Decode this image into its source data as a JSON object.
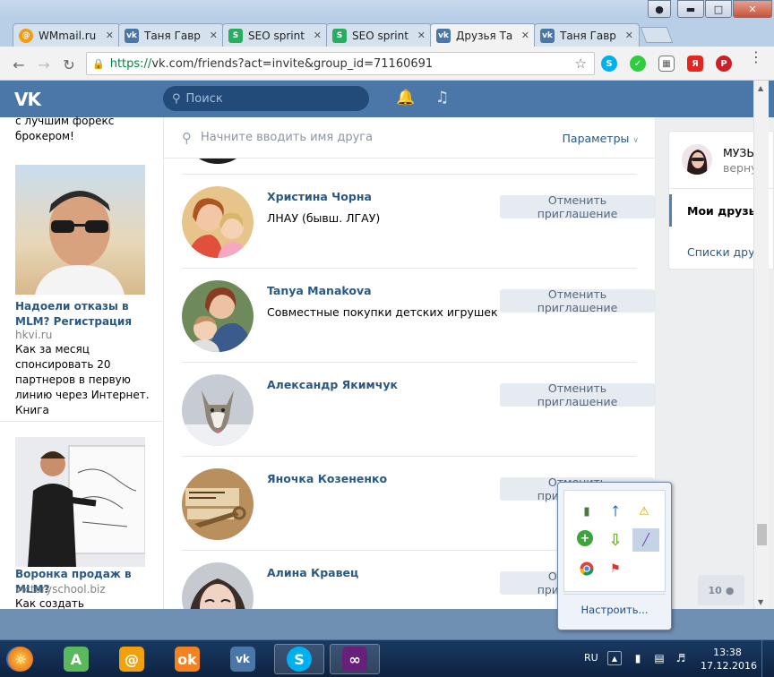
{
  "browser": {
    "tabs": [
      {
        "label": "WMmail.ru",
        "icon": "wmmail-icon",
        "icon_color": "#f39c12",
        "active": false
      },
      {
        "label": "Таня Гавр",
        "icon": "vk-icon",
        "icon_color": "#4a76a8",
        "active": false
      },
      {
        "label": "SEO sprint",
        "icon": "seosprint-icon",
        "icon_color": "#27ae60",
        "active": false
      },
      {
        "label": "SEO sprint",
        "icon": "seosprint-icon",
        "icon_color": "#27ae60",
        "active": false
      },
      {
        "label": "Друзья Та",
        "icon": "vk-icon",
        "icon_color": "#4a76a8",
        "active": true
      },
      {
        "label": "Таня Гавр",
        "icon": "vk-icon",
        "icon_color": "#4a76a8",
        "active": false
      }
    ],
    "url_scheme": "https://",
    "url_host": "vk.com",
    "url_path": "/friends?act=invite&group_id=71160691"
  },
  "vk": {
    "brand_color": "#4a76a8",
    "search_placeholder": "Поиск",
    "friend_search_placeholder": "Начните вводить имя друга",
    "params_label": "Параметры"
  },
  "ads": {
    "top_text": "с лучшим форекс брокером!",
    "items": [
      {
        "title": "Надоели отказы в MLM? Регистрация",
        "domain": "hkvi.ru",
        "text": "Как за месяц спонсировать 20 партнеров в первую линию через Интернет. Книга"
      },
      {
        "title": "Воронка продаж в MLM?",
        "domain": "victoryschool.biz",
        "text": "Как создать прибыльную"
      }
    ]
  },
  "friends": [
    {
      "name": "Христина Чорна",
      "subtitle": "ЛНАУ (бывш. ЛГАУ)",
      "action": "Отменить приглашение"
    },
    {
      "name": "Tanya Manakova",
      "subtitle": "Совместные покупки детских игрушек",
      "action": "Отменить приглашение"
    },
    {
      "name": "Александр Якимчук",
      "subtitle": "",
      "action": "Отменить приглашение"
    },
    {
      "name": "Яночка Козененко",
      "subtitle": "",
      "action": "Отменить приглашение"
    },
    {
      "name": "Алина Кравец",
      "subtitle": "",
      "action": "Отменить приглашение"
    }
  ],
  "right_menu": {
    "group_name": "МУЗЫ",
    "group_sub": "верну",
    "items": [
      {
        "label": "Мои друзья",
        "active": true
      },
      {
        "label": "Списки друз",
        "active": false
      }
    ]
  },
  "friend_counter": "10",
  "tray": {
    "configure_label": "Настроить..."
  },
  "taskbar": {
    "language": "RU",
    "time": "13:38",
    "date": "17.12.2016"
  }
}
